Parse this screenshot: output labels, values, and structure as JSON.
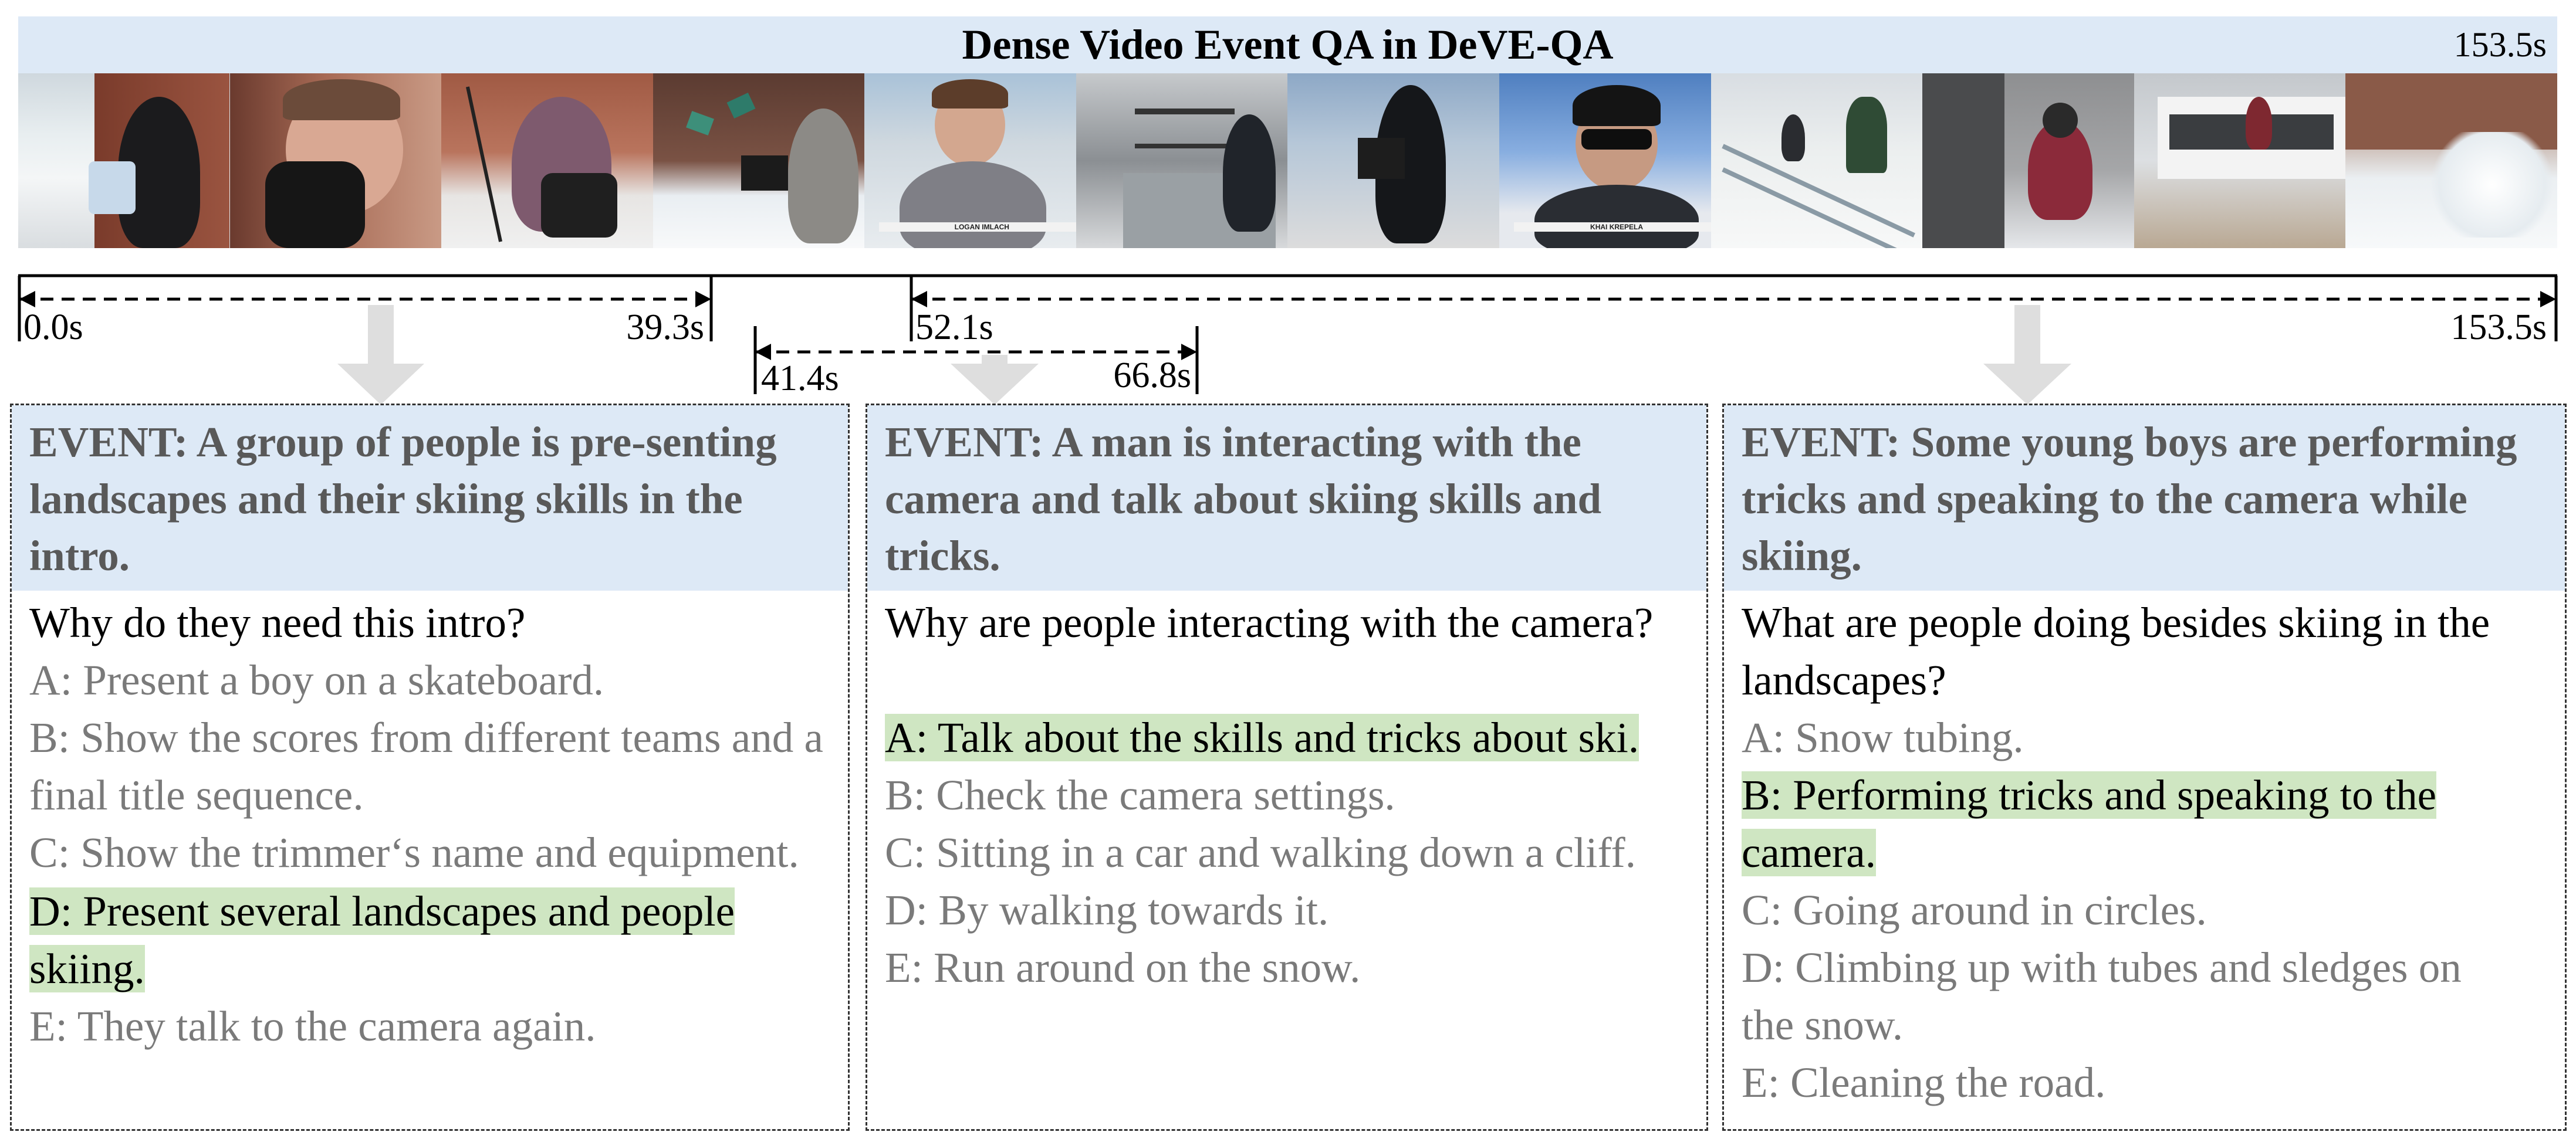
{
  "header": {
    "title": "Dense Video Event QA in DeVE-QA",
    "duration": "153.5s"
  },
  "filmstrip": {
    "frames": [
      {
        "name": "frame-1"
      },
      {
        "name": "frame-2"
      },
      {
        "name": "frame-3"
      },
      {
        "name": "frame-4"
      },
      {
        "name": "frame-5",
        "caption": "LOGAN IMLACH"
      },
      {
        "name": "frame-6"
      },
      {
        "name": "frame-7"
      },
      {
        "name": "frame-8",
        "caption": "KHAI KREPELA"
      },
      {
        "name": "frame-9"
      },
      {
        "name": "frame-10"
      },
      {
        "name": "frame-11"
      },
      {
        "name": "frame-12"
      }
    ]
  },
  "timeline": {
    "segments": [
      {
        "start_label": "0.0s",
        "end_label": "39.3s",
        "start": 0.0,
        "end": 39.3
      },
      {
        "start_label": "41.4s",
        "end_label": "66.8s",
        "start": 41.4,
        "end": 66.8
      },
      {
        "start_label": "52.1s",
        "end_label": "153.5s",
        "start": 52.1,
        "end": 153.5
      }
    ]
  },
  "panels": [
    {
      "event": "EVENT: A group of people is pre-senting landscapes and their skiing skills in the intro.",
      "question": "Why do they need this intro?",
      "options": [
        {
          "text": "A: Present a boy on a skateboard.",
          "correct": false
        },
        {
          "text": "B: Show the scores from different teams and a final title sequence.",
          "correct": false
        },
        {
          "text": "C: Show the trimmer‘s name and equipment.",
          "correct": false
        },
        {
          "text": "D: Present several landscapes and people skiing.",
          "correct": true
        },
        {
          "text": "E: They talk to the camera again.",
          "correct": false
        }
      ]
    },
    {
      "event": "EVENT: A man is interacting with the camera and talk about skiing skills and tricks.",
      "question": "Why are people interacting with the camera?",
      "options": [
        {
          "text": "A: Talk about the skills and tricks about ski.",
          "correct": true
        },
        {
          "text": "B: Check the camera settings.",
          "correct": false
        },
        {
          "text": "C: Sitting in a car and walking down a cliff.",
          "correct": false
        },
        {
          "text": "D: By walking towards it.",
          "correct": false
        },
        {
          "text": "E: Run around on the snow.",
          "correct": false
        }
      ]
    },
    {
      "event": "EVENT: Some young boys are performing tricks and speaking to the camera while skiing.",
      "question": "What are people doing besides skiing in the landscapes?",
      "options": [
        {
          "text": "A: Snow tubing.",
          "correct": false
        },
        {
          "text": "B: Performing tricks and speaking to the camera.",
          "correct": true
        },
        {
          "text": "C: Going around in circles.",
          "correct": false
        },
        {
          "text": "D: Climbing up with tubes and sledges on the snow.",
          "correct": false
        },
        {
          "text": "E: Cleaning the road.",
          "correct": false
        }
      ]
    }
  ]
}
